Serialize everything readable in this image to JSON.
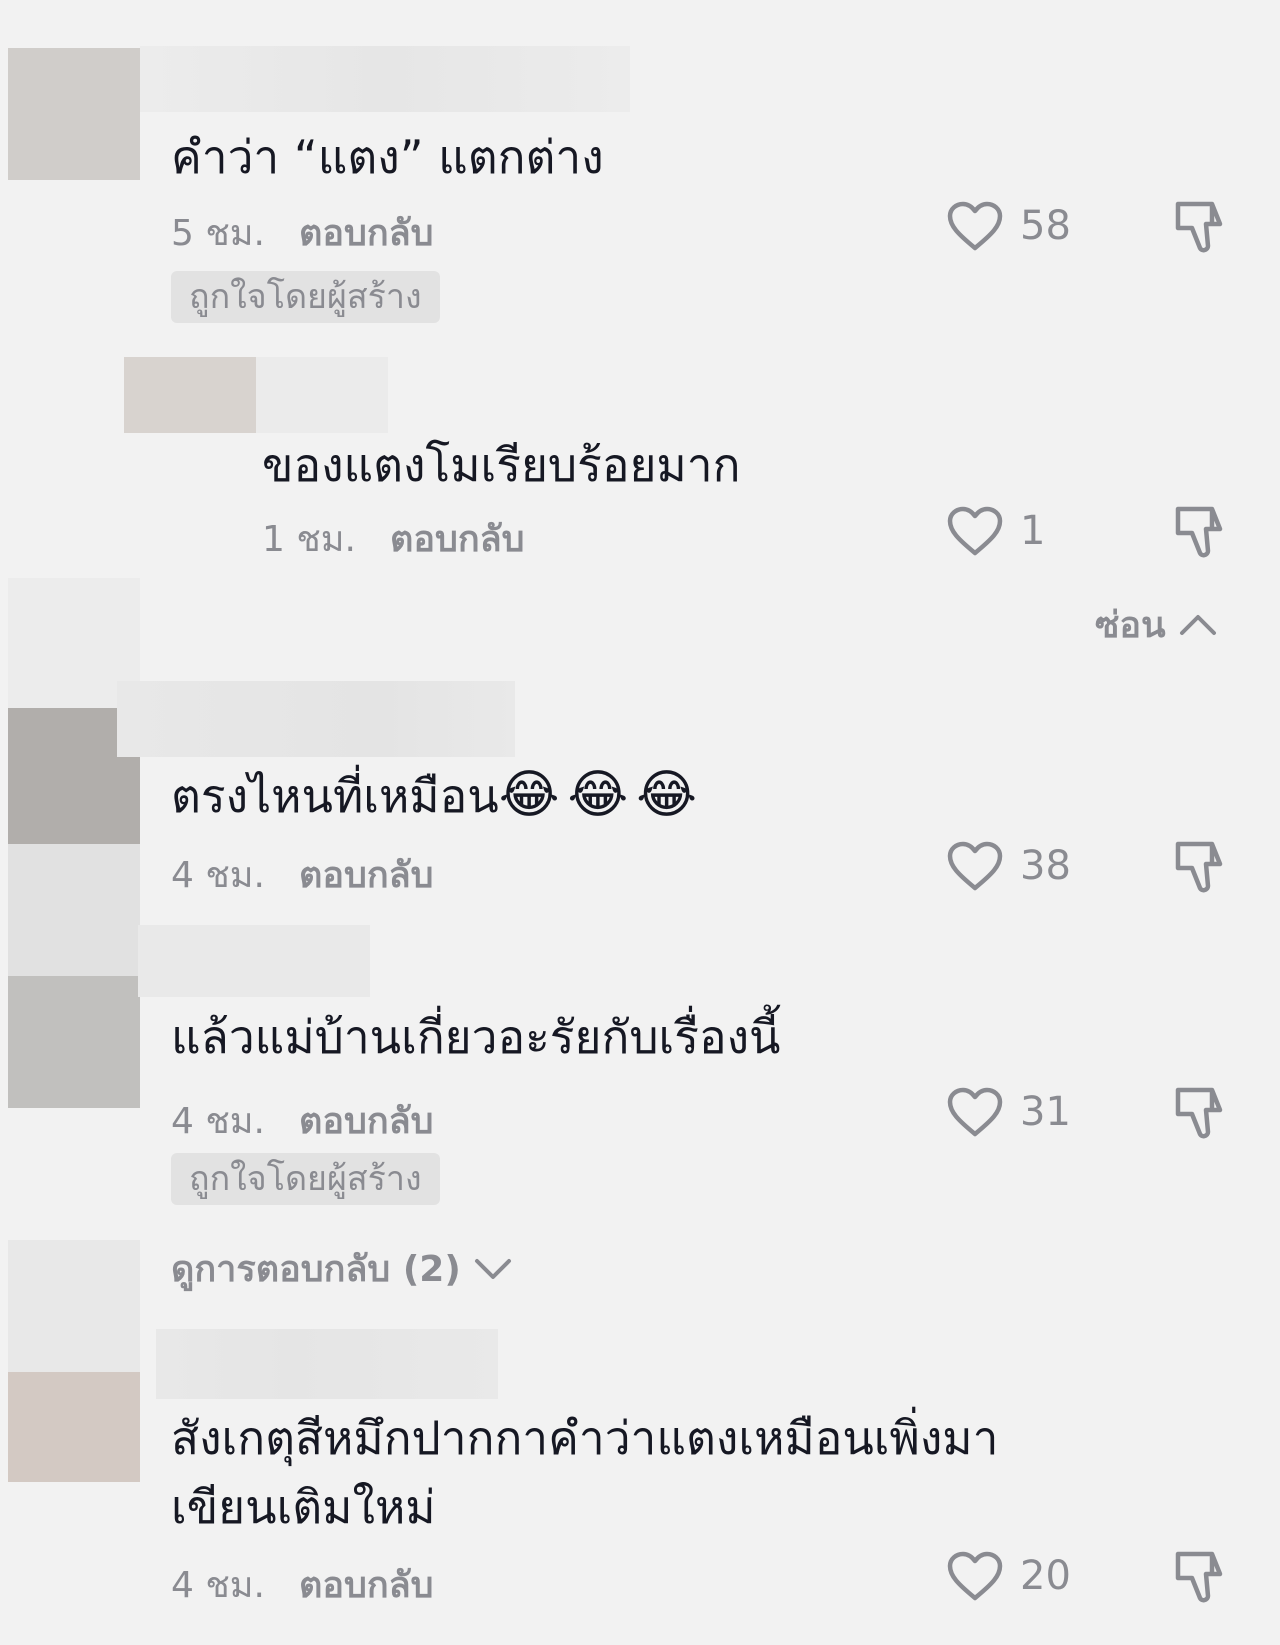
{
  "comments": [
    {
      "text": "คำว่า “แตง” แตกต่าง",
      "time": "5 ชม.",
      "reply_label": "ตอบกลับ",
      "badge": "ถูกใจโดยผู้สร้าง",
      "likes": "58"
    },
    {
      "text": "ของแตงโมเรียบร้อยมาก",
      "time": "1 ชม.",
      "reply_label": "ตอบกลับ",
      "likes": "1"
    },
    {
      "text": "ตรงไหนที่เหมือน",
      "emoji": "😂😂😂",
      "time": "4 ชม.",
      "reply_label": "ตอบกลับ",
      "likes": "38"
    },
    {
      "text": "แล้วแม่บ้านเกี่ยวอะรัยกับเรื่องนี้",
      "time": "4 ชม.",
      "reply_label": "ตอบกลับ",
      "badge": "ถูกใจโดยผู้สร้าง",
      "likes": "31"
    },
    {
      "text_line1": "สังเกตุสีหมึกปากกาคำว่าแตงเหมือนเพิ่งมา",
      "text_line2": "เขียนเติมใหม่",
      "time": "4 ชม.",
      "reply_label": "ตอบกลับ",
      "likes": "20"
    }
  ],
  "hide_replies_label": "ซ่อน",
  "view_replies_label": "ดูการตอบกลับ (2)",
  "colors": {
    "background": "#f2f2f2",
    "text": "#161823",
    "secondary": "#8a8b91",
    "badge_bg": "#e2e2e2"
  },
  "icons": [
    "heart-icon",
    "dislike-icon",
    "chevron-up-icon",
    "chevron-down-icon"
  ]
}
